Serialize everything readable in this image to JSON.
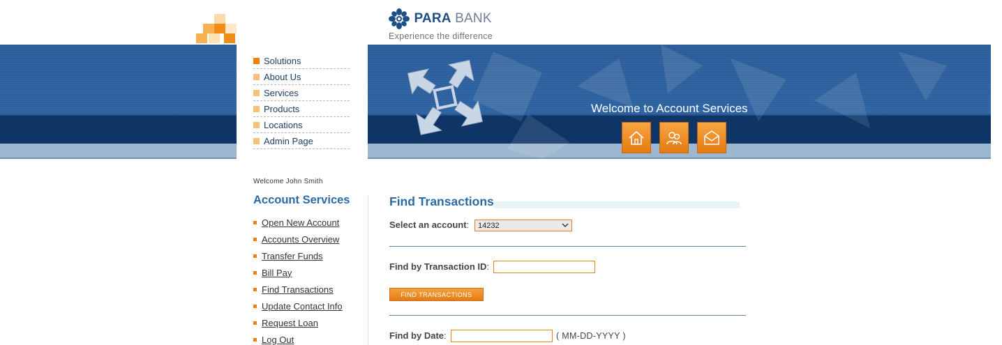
{
  "brand": {
    "name_bold": "PARA",
    "name_rest": "BANK",
    "tagline": "Experience the difference"
  },
  "top_menu": {
    "items": [
      {
        "label": "Solutions",
        "active": true
      },
      {
        "label": "About Us",
        "active": false
      },
      {
        "label": "Services",
        "active": false
      },
      {
        "label": "Products",
        "active": false
      },
      {
        "label": "Locations",
        "active": false
      },
      {
        "label": "Admin Page",
        "active": false
      }
    ]
  },
  "banner": {
    "welcome": "Welcome to Account Services",
    "buttons": [
      {
        "icon": "home-icon"
      },
      {
        "icon": "about-icon"
      },
      {
        "icon": "contact-icon"
      }
    ]
  },
  "sidebar": {
    "welcome_user": "Welcome John Smith",
    "heading": "Account Services",
    "links": [
      {
        "label": "Open New Account"
      },
      {
        "label": "Accounts Overview"
      },
      {
        "label": "Transfer Funds"
      },
      {
        "label": "Bill Pay"
      },
      {
        "label": "Find Transactions"
      },
      {
        "label": "Update Contact Info"
      },
      {
        "label": "Request Loan"
      },
      {
        "label": "Log Out"
      }
    ]
  },
  "main": {
    "title": "Find Transactions",
    "account_label": "Select an account",
    "account_value": "14232",
    "txid_label": "Find by Transaction ID",
    "txid_value": "",
    "find_button": "FIND TRANSACTIONS",
    "date_label": "Find by Date",
    "date_value": "",
    "date_hint": "( MM-DD-YYYY )"
  },
  "colors": {
    "accent": "#e8830e",
    "brand_blue": "#2a6aa6",
    "banner_blue": "#2a5c98"
  }
}
